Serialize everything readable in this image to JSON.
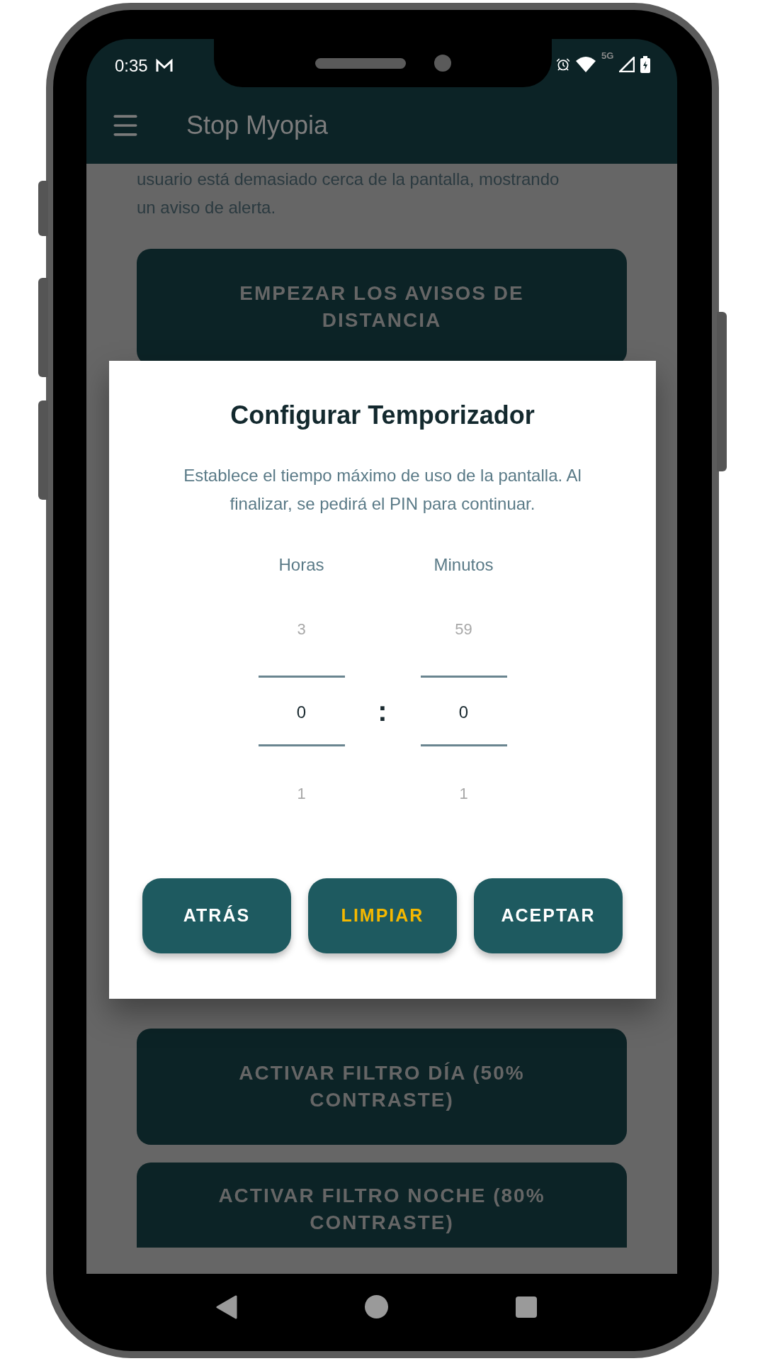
{
  "status_bar": {
    "time": "0:35",
    "network": "5G"
  },
  "app_bar": {
    "title": "Stop Myopia"
  },
  "content": {
    "intro_lines": [
      "usuario está demasiado cerca de la pantalla, mostrando",
      "un aviso de alerta."
    ],
    "buttons": [
      "EMPEZAR LOS AVISOS DE DISTANCIA",
      "ACTIVAR FILTRO DÍA (50% CONTRASTE)",
      "ACTIVAR FILTRO NOCHE (80% CONTRASTE)"
    ]
  },
  "dialog": {
    "title": "Configurar Temporizador",
    "message": "Establece el tiempo máximo de uso de la pantalla. Al finalizar, se pedirá el PIN para continuar.",
    "pickers": [
      {
        "label": "Horas",
        "previous": "3",
        "value": "0",
        "next": "1"
      },
      {
        "label": "Minutos",
        "previous": "59",
        "value": "0",
        "next": "1"
      }
    ],
    "separator": ":",
    "buttons": [
      {
        "label": "ATRÁS",
        "highlighted": false
      },
      {
        "label": "LIMPIAR",
        "highlighted": true
      },
      {
        "label": "ACEPTAR",
        "highlighted": false
      }
    ]
  }
}
